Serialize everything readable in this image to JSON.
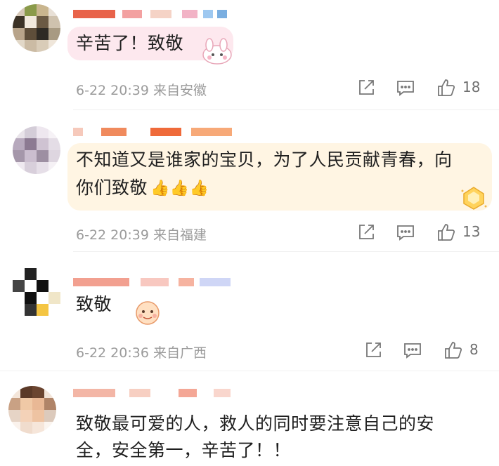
{
  "comments": [
    {
      "text_lines": [
        "辛苦了！致敬"
      ],
      "date": "6-22",
      "time": "20:39",
      "location": "来自安徽",
      "likes": "18",
      "bubble_color": "#fde8ee",
      "sticker": "bunny-sticker"
    },
    {
      "text_lines": [
        "不知道又是谁家的宝贝，为了人民贡献青春，向",
        "你们致敬"
      ],
      "emoji": "👍👍👍",
      "date": "6-22",
      "time": "20:39",
      "location": "来自福建",
      "likes": "13",
      "bubble_color": "#fff5e3",
      "sticker": "medal-sticker"
    },
    {
      "text_lines": [
        "致敬"
      ],
      "date": "6-22",
      "time": "20:36",
      "location": "来自广西",
      "likes": "8",
      "bubble_color": "#ffffff",
      "sticker": "face-sticker"
    },
    {
      "text_lines": [
        "致敬最可爱的人，救人的同时要注意自己的安",
        "全，安全第一，辛苦了！！"
      ],
      "bubble_color": "#ffffff"
    }
  ],
  "icons": {
    "share": "share-icon",
    "comment": "comment-icon",
    "like": "thumbs-up-icon"
  }
}
